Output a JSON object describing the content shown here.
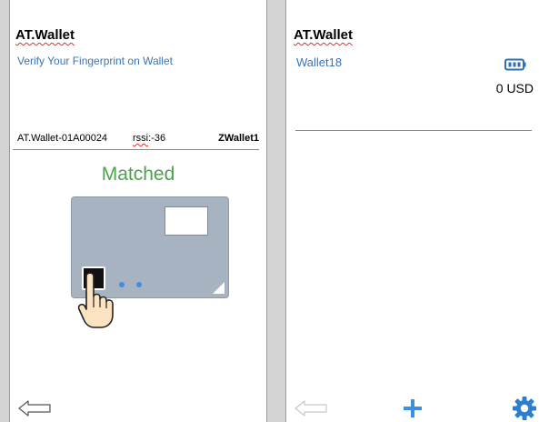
{
  "left_screen": {
    "app_title": "AT.Wallet",
    "instruction": "Verify Your Fingerprint on Wallet",
    "device_id": "AT.Wallet-01A00024",
    "rssi_key": "rssi",
    "rssi_value": ":-36",
    "wallet_name": "ZWallet1",
    "status": "Matched",
    "icons": {
      "back": "back-arrow-icon",
      "card": "hardware-wallet-card-icon",
      "hand": "fingerprint-hand-icon"
    }
  },
  "right_screen": {
    "app_title": "AT.Wallet",
    "wallet_name": "Wallet18",
    "balance": "0 USD",
    "icons": {
      "battery": "battery-icon",
      "back": "back-arrow-icon",
      "add": "plus-icon",
      "settings": "gear-icon"
    }
  },
  "colors": {
    "link_blue": "#3b73b9",
    "status_green": "#4aa24a",
    "card_gray": "#a8b3c1",
    "accent_blue": "#3b8fe0",
    "gutter": "#d4d4d4"
  }
}
